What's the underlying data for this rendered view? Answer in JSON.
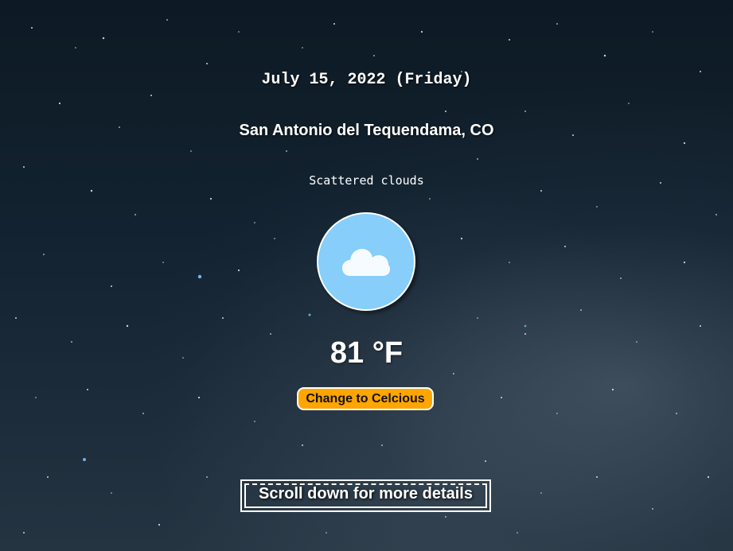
{
  "weather": {
    "date": "July 15, 2022 (Friday)",
    "location": "San Antonio del Tequendama, CO",
    "condition": "Scattered clouds",
    "icon": "cloud-icon",
    "temperature": "81 °F",
    "unit_button_label": "Change to Celcious",
    "scroll_hint": "Scroll down for more details"
  },
  "colors": {
    "icon_background": "#87cefa",
    "button_background": "#ffa500",
    "text": "#ffffff"
  },
  "background": {
    "description": "starry-night-sky"
  }
}
